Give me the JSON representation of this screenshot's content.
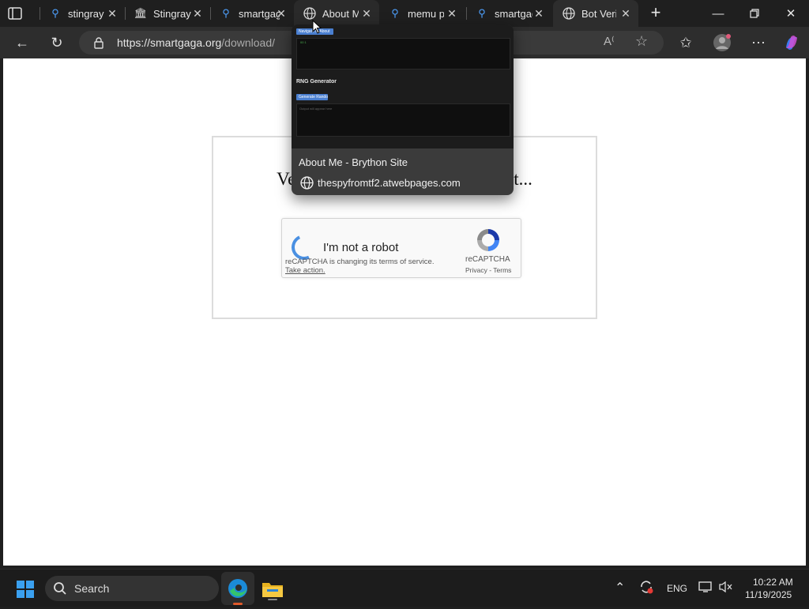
{
  "tabs": [
    {
      "label": "stingray",
      "icon": "search-icon"
    },
    {
      "label": "Stingray",
      "icon": "library-icon"
    },
    {
      "label": "smartgaga",
      "icon": "search-icon"
    },
    {
      "label": "About Me",
      "icon": "globe-icon"
    },
    {
      "label": "memu pl",
      "icon": "search-icon"
    },
    {
      "label": "smartgaga",
      "icon": "search-icon"
    },
    {
      "label": "Bot Verification",
      "icon": "globe-icon",
      "active": true
    }
  ],
  "address": {
    "base": "https://smartgaga.org",
    "path": "/download/"
  },
  "page": {
    "title": "Verifying that you are not a robot...",
    "recaptcha": {
      "checkbox_label": "I'm not a robot",
      "terms_note": "reCAPTCHA is changing its terms of service.",
      "take_action": "Take action.",
      "brand": "reCAPTCHA",
      "privacy": "Privacy",
      "separator": " - ",
      "terms": "Terms"
    }
  },
  "tab_preview": {
    "title": "About Me - Brython Site",
    "url": "thespyfromtf2.atwebpages.com",
    "thumb": {
      "button1": "Navigate to About",
      "heading": "RNG Generator",
      "button2": "Generate Random",
      "hint": "Output will appear here",
      "code": "00 1"
    }
  },
  "taskbar": {
    "search": "Search",
    "language": "ENG",
    "time": "10:22 AM",
    "date": "11/19/2025"
  },
  "colors": {
    "accent": "#4a90e2",
    "edge_active": "#e05a2b"
  }
}
